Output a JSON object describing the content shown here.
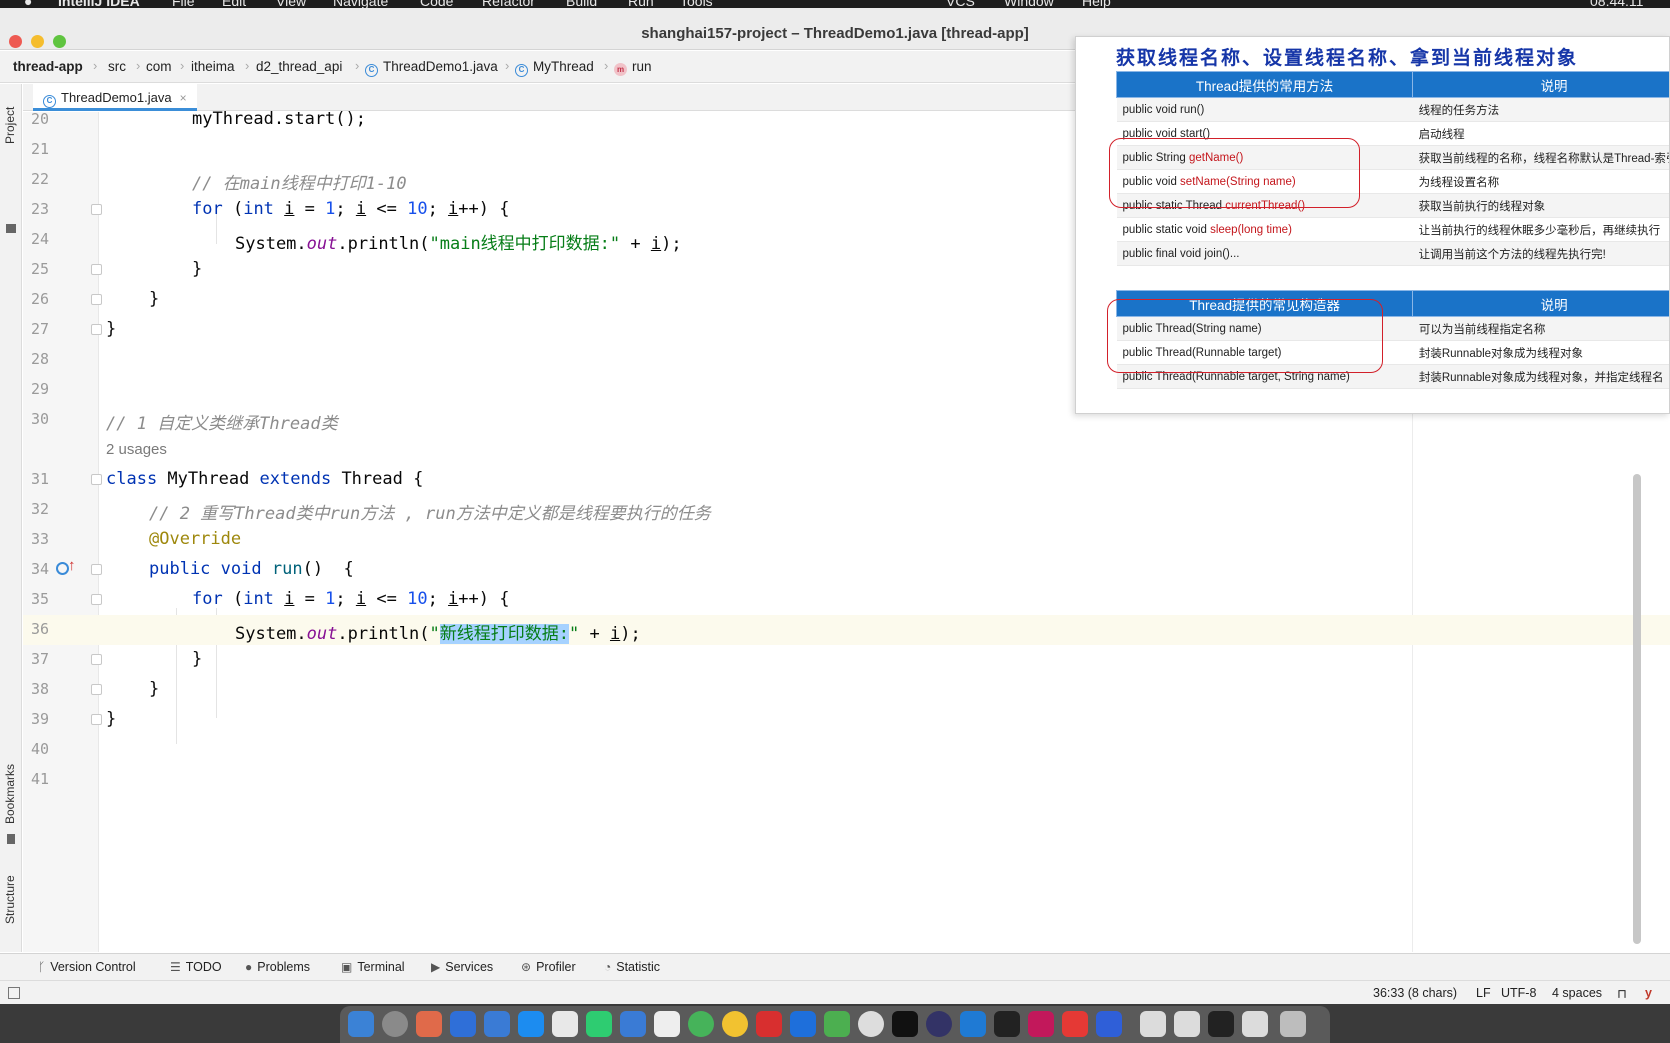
{
  "menubar": {
    "app_name": "IntelliJ IDEA",
    "items": [
      "File",
      "Edit",
      "View",
      "Navigate",
      "Code",
      "Refactor",
      "Build",
      "Run",
      "Tools",
      "VCS",
      "Window",
      "Help"
    ],
    "clock": "08:44:11"
  },
  "window": {
    "title": "shanghai157-project – ThreadDemo1.java [thread-app]"
  },
  "breadcrumb": {
    "project": "thread-app",
    "items": [
      "src",
      "com",
      "itheima",
      "d2_thread_api",
      "ThreadDemo1.java",
      "MyThread",
      "run"
    ]
  },
  "left_stripe": {
    "project": "Project",
    "bookmarks": "Bookmarks",
    "structure": "Structure"
  },
  "editor_tab": {
    "label": "ThreadDemo1.java",
    "close": "×"
  },
  "code": {
    "line_numbers": [
      "20",
      "21",
      "22",
      "23",
      "24",
      "25",
      "26",
      "27",
      "28",
      "29",
      "30",
      "31",
      "32",
      "33",
      "34",
      "35",
      "36",
      "37",
      "38",
      "39",
      "40",
      "41"
    ],
    "usages": "2 usages",
    "l20": "myThread.start();",
    "l22": "// 在main线程中打印1-10",
    "l24_str": "\"main线程中打印数据:\"",
    "l30": "// 1 自定义类继承Thread类",
    "l32": "// 2 重写Thread类中run方法 , run方法中定义都是线程要执行的任务",
    "l33": "@Override",
    "l36_sel": "新线程打印数据:",
    "cursor_line": "36"
  },
  "overlay": {
    "title": "获取线程名称、设置线程名称、拿到当前线程对象",
    "table1": {
      "headers": [
        "Thread提供的常用方法",
        "说明"
      ],
      "rows": [
        [
          "public void run()",
          "线程的任务方法"
        ],
        [
          "public void start()",
          "启动线程"
        ],
        [
          "public String getName()",
          "获取当前线程的名称，线程名称默认是Thread-索引"
        ],
        [
          "public void setName(String name)",
          "为线程设置名称"
        ],
        [
          "public static Thread currentThread()",
          "获取当前执行的线程对象"
        ],
        [
          "public static void sleep(long time)",
          "让当前执行的线程休眠多少毫秒后，再继续执行"
        ],
        [
          "public final void join()...",
          "让调用当前这个方法的线程先执行完!"
        ]
      ]
    },
    "table2": {
      "headers": [
        "Thread提供的常见构造器",
        "说明"
      ],
      "rows": [
        [
          "public Thread(String name)",
          "可以为当前线程指定名称"
        ],
        [
          "public Thread(Runnable target)",
          "封装Runnable对象成为线程对象"
        ],
        [
          "public Thread(Runnable target, String name)",
          "封装Runnable对象成为线程对象，并指定线程名"
        ]
      ]
    }
  },
  "tool_windows": [
    "Version Control",
    "TODO",
    "Problems",
    "Terminal",
    "Services",
    "Profiler",
    "Statistic"
  ],
  "status": {
    "position": "36:33 (8 chars)",
    "line_sep": "LF",
    "encoding": "UTF-8",
    "indent": "4 spaces"
  },
  "colors": {
    "keyword": "#0033b3",
    "string": "#067d17",
    "number": "#1750eb",
    "comment": "#8c8c8c",
    "annotation": "#9e880d",
    "selection": "#a6d2ff",
    "overlay_header": "#1a73c8",
    "overlay_highlight": "#c4161c"
  }
}
